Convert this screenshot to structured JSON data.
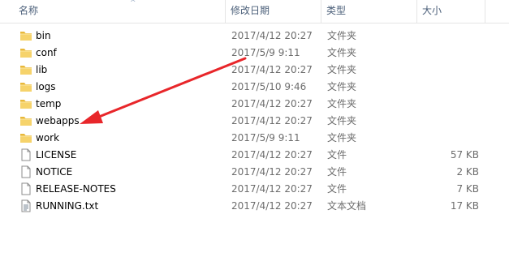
{
  "header": {
    "name": "名称",
    "date": "修改日期",
    "type": "类型",
    "size": "大小",
    "sort_arrow": "^"
  },
  "files": [
    {
      "name": "bin",
      "date": "2017/4/12 20:27",
      "type": "文件夹",
      "size": "",
      "icon": "folder-icon"
    },
    {
      "name": "conf",
      "date": "2017/5/9 9:11",
      "type": "文件夹",
      "size": "",
      "icon": "folder-icon"
    },
    {
      "name": "lib",
      "date": "2017/4/12 20:27",
      "type": "文件夹",
      "size": "",
      "icon": "folder-icon"
    },
    {
      "name": "logs",
      "date": "2017/5/10 9:46",
      "type": "文件夹",
      "size": "",
      "icon": "folder-icon"
    },
    {
      "name": "temp",
      "date": "2017/4/12 20:27",
      "type": "文件夹",
      "size": "",
      "icon": "folder-icon"
    },
    {
      "name": "webapps",
      "date": "2017/4/12 20:27",
      "type": "文件夹",
      "size": "",
      "icon": "folder-icon"
    },
    {
      "name": "work",
      "date": "2017/5/9 9:11",
      "type": "文件夹",
      "size": "",
      "icon": "folder-icon"
    },
    {
      "name": "LICENSE",
      "date": "2017/4/12 20:27",
      "type": "文件",
      "size": "57 KB",
      "icon": "file-icon"
    },
    {
      "name": "NOTICE",
      "date": "2017/4/12 20:27",
      "type": "文件",
      "size": "2 KB",
      "icon": "file-icon"
    },
    {
      "name": "RELEASE-NOTES",
      "date": "2017/4/12 20:27",
      "type": "文件",
      "size": "7 KB",
      "icon": "file-icon"
    },
    {
      "name": "RUNNING.txt",
      "date": "2017/4/12 20:27",
      "type": "文本文档",
      "size": "17 KB",
      "icon": "text-file-icon"
    }
  ],
  "annotation": {
    "arrow_color": "#e8262a",
    "points_to": "webapps"
  }
}
